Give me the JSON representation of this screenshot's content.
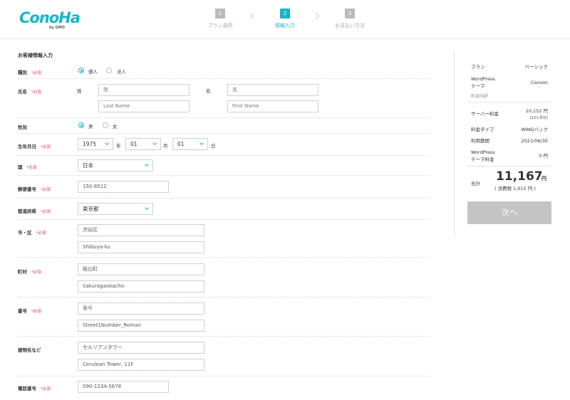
{
  "header": {
    "logo": "ConoHa",
    "logo_sub": "by GMO",
    "steps": [
      {
        "num": "1",
        "label": "プラン選択"
      },
      {
        "num": "2",
        "label": "情報入力"
      },
      {
        "num": "3",
        "label": "お支払い方法"
      }
    ],
    "active_step": 2,
    "accent_color": "#18b5c8"
  },
  "form": {
    "title": "お客様情報入力",
    "required_mark": "*必須",
    "type": {
      "label": "種別",
      "options": [
        "個人",
        "法人"
      ],
      "selected": "個人"
    },
    "name": {
      "label": "氏名",
      "last_label": "姓",
      "first_label": "名",
      "last_placeholder": "姓",
      "first_placeholder": "名",
      "last_roman_placeholder": "Last Name",
      "first_roman_placeholder": "First Name"
    },
    "gender": {
      "label": "性別",
      "options": [
        "男",
        "女"
      ],
      "selected": "男"
    },
    "birthday": {
      "label": "生年月日",
      "year": "1975",
      "year_unit": "年",
      "month": "01",
      "month_unit": "月",
      "day": "01",
      "day_unit": "日"
    },
    "country": {
      "label": "国",
      "value": "日本"
    },
    "postal": {
      "label": "郵便番号",
      "value": "150-8512"
    },
    "prefecture": {
      "label": "都道府県",
      "value": "東京都"
    },
    "city": {
      "label": "市・区",
      "value": "渋谷区",
      "roman": "Shibuya-ku"
    },
    "town": {
      "label": "町村",
      "value": "桜丘町",
      "roman": "Sakuragaokacho"
    },
    "street": {
      "label": "番号",
      "placeholder": "番号",
      "roman": "Street1Number_Roman"
    },
    "building": {
      "label": "建物名など",
      "value": "セルリアンタワー",
      "roman": "Cerulean Tower, 11F"
    },
    "phone": {
      "label": "電話番号",
      "value": "090-1234-5678"
    }
  },
  "summary": {
    "plan_label": "プラン",
    "plan_value": "ベーシック",
    "theme_label_1": "WordPress",
    "theme_label_2": "テーマ",
    "theme_value": "Cocoon",
    "breakdown_label": "料金内訳",
    "server_label": "サーバー料金",
    "server_value": "10,152 円",
    "server_sub": "(12ヶ月分)",
    "fee_type_label": "料金タイプ",
    "fee_type_value": "WINGパック",
    "period_label": "利用期間",
    "period_value": "2021/06/30",
    "theme_fee_label_1": "WordPress",
    "theme_fee_label_2": "テーマ料金",
    "theme_fee_value": "0 円",
    "total_label": "合計",
    "total_value": "11,167",
    "total_unit": "円",
    "tax_text": "( 消費税 1,015 円 )",
    "next_button": "次へ"
  }
}
